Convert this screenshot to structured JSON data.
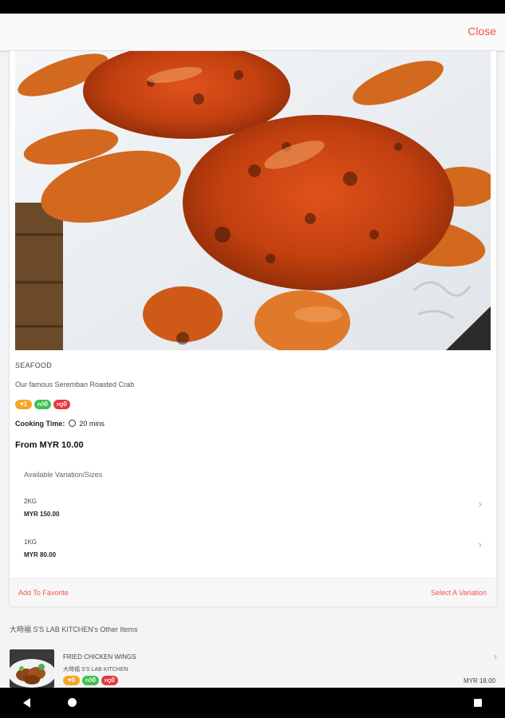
{
  "header": {
    "close_label": "Close"
  },
  "item": {
    "category": "SEAFOOD",
    "description": "Our famous Seremban Roasted Crab",
    "badges": [
      "1",
      "0",
      "0"
    ],
    "cooking_time_label": "Cooking Time:",
    "cooking_time_value": "20 mins",
    "from_price": "From MYR 10.00"
  },
  "variations": {
    "title": "Available Variation/Sizes",
    "items": [
      {
        "name": "2KG",
        "price": "MYR 150.00"
      },
      {
        "name": "1KG",
        "price": "MYR 80.00"
      }
    ]
  },
  "footer": {
    "favorite_label": "Add To Favorite",
    "select_label": "Select A Variation"
  },
  "other_items": {
    "title": "大時福 S'S LAB KITCHEN's Other Items",
    "items": [
      {
        "name": "FRIED CHICKEN WINGS",
        "shop": "大時福 S'S LAB KITCHEN",
        "badges": [
          "0",
          "0",
          "0"
        ],
        "price": "MYR 18.00"
      }
    ]
  },
  "colors": {
    "accent": "#f2554b",
    "badge_orange": "#f5a623",
    "badge_green": "#3ec14f",
    "badge_red": "#e8363c"
  }
}
